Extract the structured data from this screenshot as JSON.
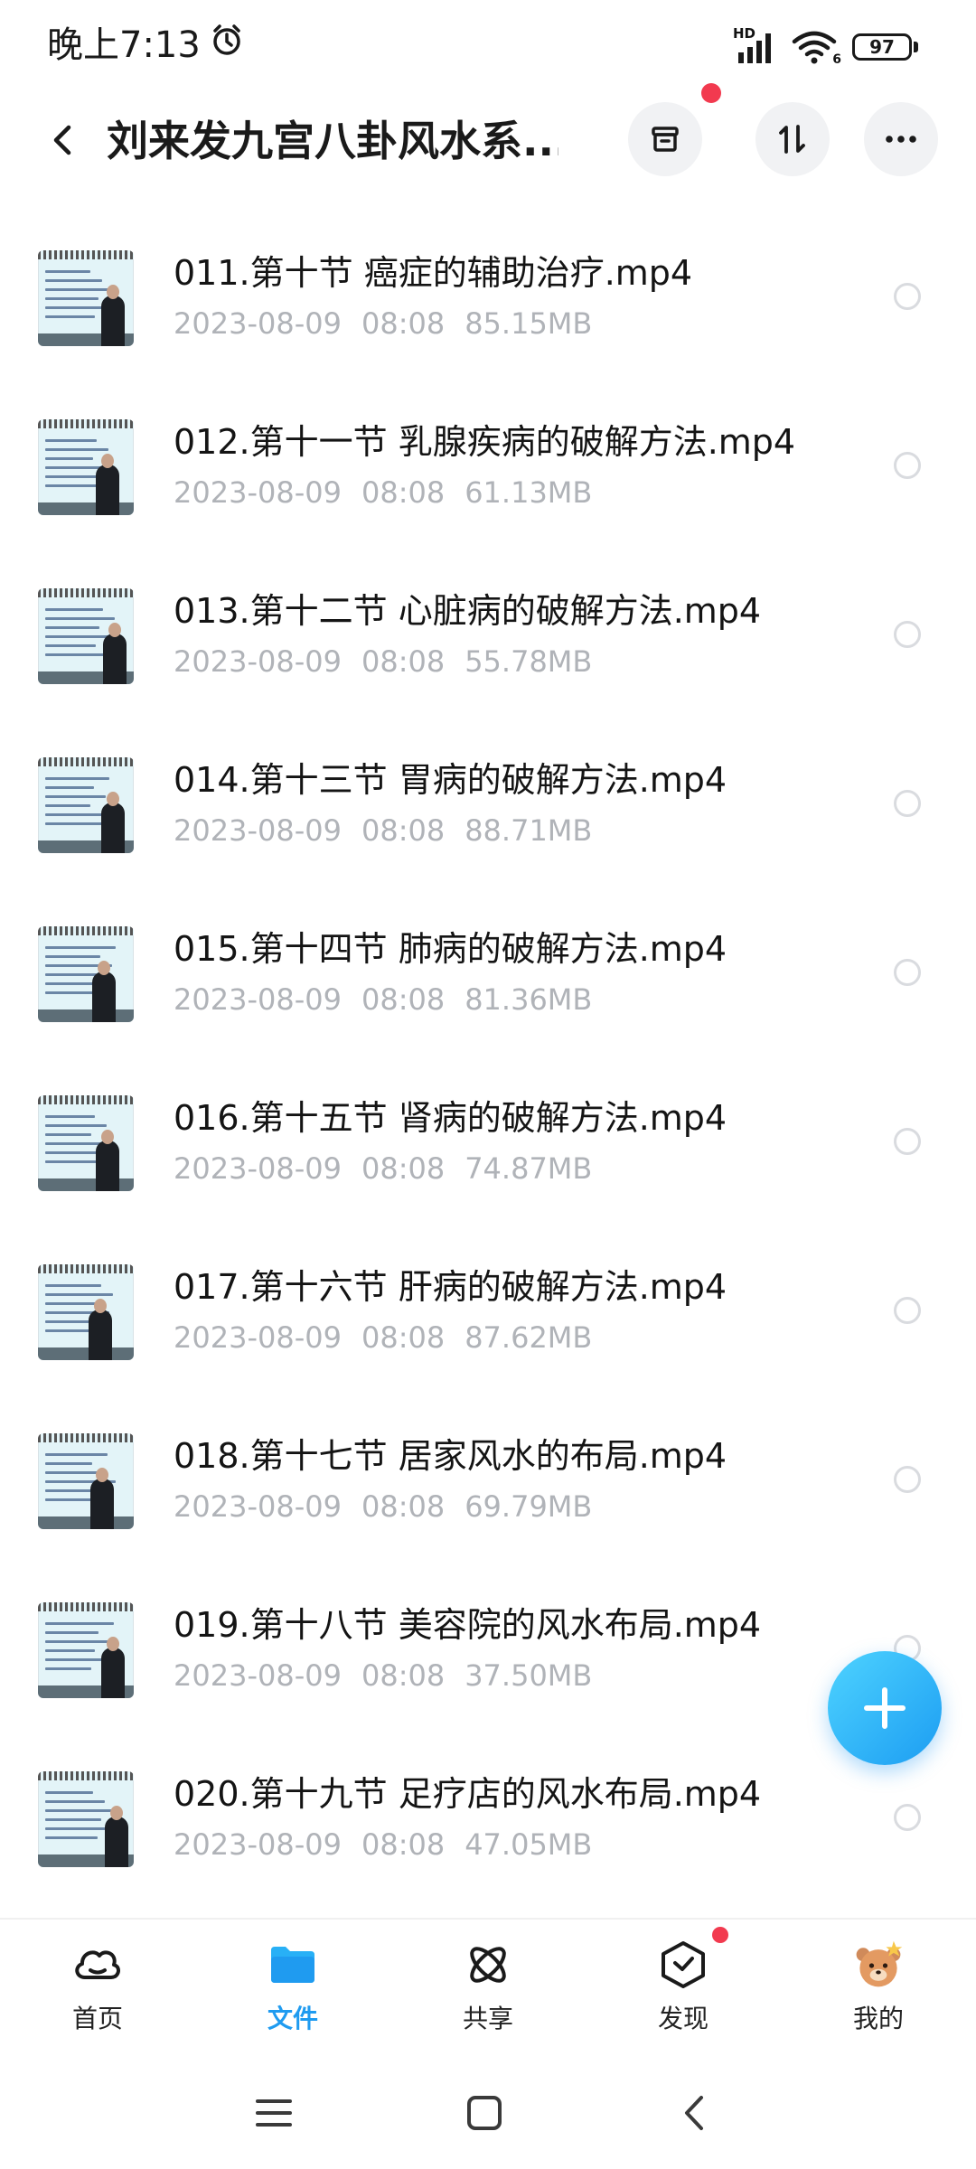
{
  "status_bar": {
    "time": "晚上7:13",
    "network": "HD",
    "wifi_sub": "6",
    "battery": "97"
  },
  "header": {
    "title": "刘来发九宫八卦风水系..."
  },
  "files": [
    {
      "name": "011.第十节  癌症的辅助治疗.mp4",
      "date": "2023-08-09",
      "time": "08:08",
      "size": "85.15MB"
    },
    {
      "name": "012.第十一节 乳腺疾病的破解方法.mp4",
      "date": "2023-08-09",
      "time": "08:08",
      "size": "61.13MB"
    },
    {
      "name": "013.第十二节 心脏病的破解方法.mp4",
      "date": "2023-08-09",
      "time": "08:08",
      "size": "55.78MB"
    },
    {
      "name": "014.第十三节 胃病的破解方法.mp4",
      "date": "2023-08-09",
      "time": "08:08",
      "size": "88.71MB"
    },
    {
      "name": "015.第十四节 肺病的破解方法.mp4",
      "date": "2023-08-09",
      "time": "08:08",
      "size": "81.36MB"
    },
    {
      "name": "016.第十五节 肾病的破解方法.mp4",
      "date": "2023-08-09",
      "time": "08:08",
      "size": "74.87MB"
    },
    {
      "name": "017.第十六节 肝病的破解方法.mp4",
      "date": "2023-08-09",
      "time": "08:08",
      "size": "87.62MB"
    },
    {
      "name": "018.第十七节 居家风水的布局.mp4",
      "date": "2023-08-09",
      "time": "08:08",
      "size": "69.79MB"
    },
    {
      "name": "019.第十八节 美容院的风水布局.mp4",
      "date": "2023-08-09",
      "time": "08:08",
      "size": "37.50MB"
    },
    {
      "name": "020.第十九节  足疗店的风水布局.mp4",
      "date": "2023-08-09",
      "time": "08:08",
      "size": "47.05MB"
    }
  ],
  "tabs": [
    {
      "label": "首页",
      "icon": "cloud-icon"
    },
    {
      "label": "文件",
      "icon": "folder-icon"
    },
    {
      "label": "共享",
      "icon": "share-atom-icon"
    },
    {
      "label": "发现",
      "icon": "discover-cube-icon"
    },
    {
      "label": "我的",
      "icon": "bear-avatar-icon"
    }
  ],
  "active_tab": "文件",
  "colors": {
    "accent": "#1f9bf0",
    "badge": "#f23a4f",
    "meta_text": "#b0b3b8"
  }
}
